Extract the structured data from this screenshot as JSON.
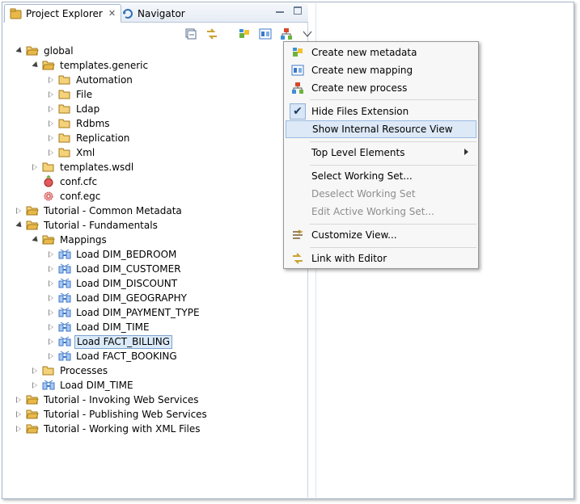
{
  "tabs": [
    {
      "label": "Project Explorer",
      "active": true
    },
    {
      "label": "Navigator",
      "active": false
    }
  ],
  "toolbar_icons": [
    "collapse-all-icon",
    "link-editor-icon",
    "create-metadata-icon",
    "create-mapping-icon",
    "create-process-icon",
    "view-menu-icon"
  ],
  "tree": {
    "global": "global",
    "templates_generic": "templates.generic",
    "automation": "Automation",
    "file": "File",
    "ldap": "Ldap",
    "rdbms": "Rdbms",
    "replication": "Replication",
    "xml": "Xml",
    "templates_wsdl": "templates.wsdl",
    "conf_cfc": "conf.cfc",
    "conf_egc": "conf.egc",
    "tut_common_metadata": "Tutorial - Common Metadata",
    "tut_fundamentals": "Tutorial - Fundamentals",
    "mappings": "Mappings",
    "load_dim_bedroom": "Load DIM_BEDROOM",
    "load_dim_customer": "Load DIM_CUSTOMER",
    "load_dim_discount": "Load DIM_DISCOUNT",
    "load_dim_geography": "Load DIM_GEOGRAPHY",
    "load_dim_payment_type": "Load DIM_PAYMENT_TYPE",
    "load_dim_time": "Load DIM_TIME",
    "load_fact_billing": "Load FACT_BILLING",
    "load_fact_booking": "Load FACT_BOOKING",
    "processes": "Processes",
    "load_dim_time_proc": "Load DIM_TIME",
    "tut_invoking_ws": "Tutorial - Invoking Web Services",
    "tut_publishing_ws": "Tutorial - Publishing Web Services",
    "tut_working_xml": "Tutorial - Working with XML Files"
  },
  "menu": {
    "create_metadata": "Create new metadata",
    "create_mapping": "Create new mapping",
    "create_process": "Create new process",
    "hide_files_extension": "Hide Files Extension",
    "show_internal_resource_view": "Show Internal Resource View",
    "top_level_elements": "Top Level Elements",
    "select_working_set": "Select Working Set...",
    "deselect_working_set": "Deselect Working Set",
    "edit_active_working_set": "Edit Active Working Set...",
    "customize_view": "Customize View...",
    "link_with_editor": "Link with Editor"
  },
  "colors": {
    "selection_bg": "#dbeaf9",
    "selection_border": "#7da2ce",
    "folder": "#e8b94a",
    "mapping_blue": "#3d78c9",
    "menu_hover": "#dde9f7",
    "disabled_text": "#8d8d8d"
  }
}
